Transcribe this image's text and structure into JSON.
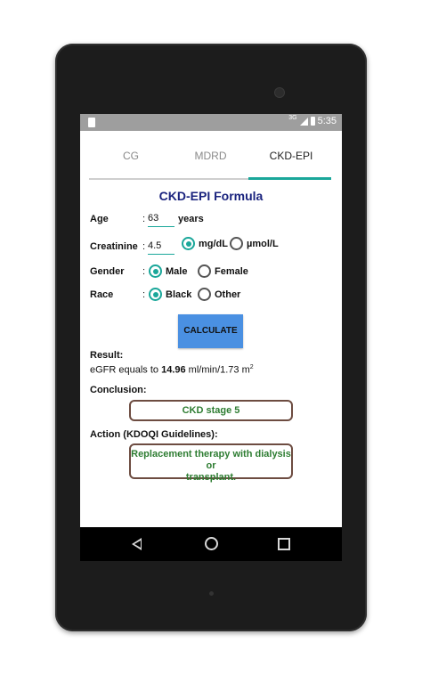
{
  "status_bar": {
    "network": "3G",
    "time": "5:35"
  },
  "tabs": [
    {
      "label": "CG"
    },
    {
      "label": "MDRD"
    },
    {
      "label": "CKD-EPI",
      "selected": true
    }
  ],
  "form": {
    "title": "CKD-EPI Formula",
    "age": {
      "label": "Age",
      "colon": ":",
      "value": "63",
      "unit": "years"
    },
    "creatinine": {
      "label": "Creatinine",
      "colon": ":",
      "value": "4.5",
      "units": [
        "mg/dL",
        "µmol/L"
      ],
      "selected_unit": "mg/dL"
    },
    "gender": {
      "label": "Gender",
      "colon": ":",
      "options": [
        "Male",
        "Female"
      ],
      "selected": "Male"
    },
    "race": {
      "label": "Race",
      "colon": ":",
      "options": [
        "Black",
        "Other"
      ],
      "selected": "Black"
    },
    "calculate_label": "CALCULATE"
  },
  "result": {
    "heading": "Result:",
    "prefix": "eGFR equals to ",
    "value": "14.96",
    "unit": " ml/min/1.73 m",
    "unit_sup": "2"
  },
  "conclusion": {
    "heading": "Conclusion:",
    "text": "CKD stage 5"
  },
  "action": {
    "heading": "Action (KDOQI Guidelines):",
    "line1": "Replacement therapy with dialysis or",
    "line2": "transplant."
  },
  "colors": {
    "accent": "#1aa79a",
    "title": "#1a237e",
    "button": "#4a90e2",
    "box_border": "#6d4c41",
    "box_text": "#2e7d32"
  }
}
